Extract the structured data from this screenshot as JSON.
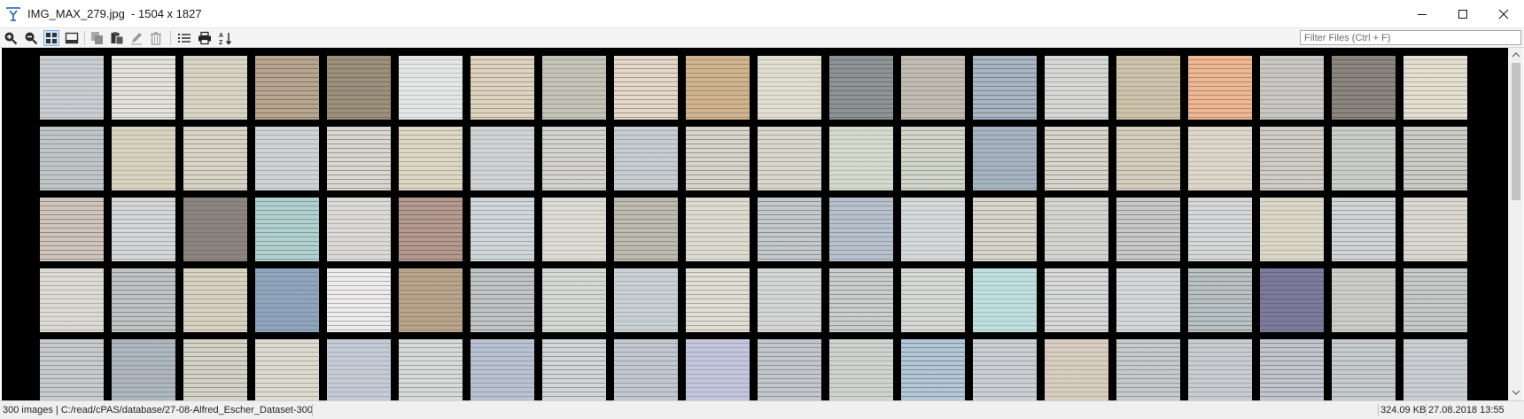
{
  "window": {
    "title": "IMG_MAX_279.jpg  - 1504 x 1827"
  },
  "toolbar": {
    "buttons": [
      {
        "name": "zoom-in",
        "icon": "zoom-in-icon"
      },
      {
        "name": "zoom-out",
        "icon": "zoom-out-icon"
      },
      {
        "name": "grid-view",
        "icon": "grid-view-icon",
        "active": true
      },
      {
        "name": "single-view",
        "icon": "single-view-icon"
      },
      {
        "name": "copy",
        "icon": "copy-icon",
        "disabled": true
      },
      {
        "name": "paste",
        "icon": "paste-icon"
      },
      {
        "name": "rename",
        "icon": "pencil-icon",
        "disabled": true
      },
      {
        "name": "delete",
        "icon": "trash-icon",
        "disabled": true
      },
      {
        "name": "list",
        "icon": "list-icon"
      },
      {
        "name": "print",
        "icon": "printer-icon"
      },
      {
        "name": "sort",
        "icon": "sort-az-icon"
      }
    ],
    "filter_placeholder": "Filter Files (Ctrl + F)"
  },
  "gallery": {
    "columns": 20,
    "visible_rows": 5,
    "thumbnail_tints": [
      [
        "#c9ccd0",
        "#e3e2dc",
        "#d8d5c6",
        "#b7a790",
        "#9b907c",
        "#e4e6e6",
        "#ddd3bf",
        "#c4c3b7",
        "#e4d7cb",
        "#d0b490",
        "#e0ddd1",
        "#8e9396",
        "#c1bcb3",
        "#a8b5c3",
        "#d7d8d6",
        "#cdc2ac",
        "#edb892",
        "#c8c7c4",
        "#8b8580",
        "#e3e0d2"
      ],
      [
        "#c0c5c8",
        "#d7d3c0",
        "#d8d5c8",
        "#d0d3d6",
        "#d9d7cf",
        "#dcd8c4",
        "#cfd3d6",
        "#d3d3cf",
        "#c8cdd2",
        "#d6d5cc",
        "#d8d7ce",
        "#d6dace",
        "#d2d5c9",
        "#a6b3c0",
        "#d7d5cc",
        "#d5cebf",
        "#dcd7ca",
        "#d0cdc6",
        "#c8cdc9",
        "#cbcdc6"
      ],
      [
        "#d0c5bd",
        "#d4d6d7",
        "#8c8480",
        "#b1d1d0",
        "#dad9d6",
        "#b49a90",
        "#cfd7da",
        "#dcdcd4",
        "#bdbcb1",
        "#dddbd1",
        "#c3c9cc",
        "#b7c1ce",
        "#d5d8d8",
        "#d8d5cb",
        "#d3d3d0",
        "#c7c8c8",
        "#d5d7d8",
        "#dad6c8",
        "#d1d5d6",
        "#dad8d0"
      ],
      [
        "#dcdad4",
        "#c0c3c4",
        "#d7d3c3",
        "#8fa5bd",
        "#ededed",
        "#b8a48c",
        "#bfc4c6",
        "#d5d9d4",
        "#c9d0d4",
        "#e0dfd6",
        "#d4d6d6",
        "#c9cfcd",
        "#d6d8d5",
        "#bfdfdf",
        "#d7d9d8",
        "#d4d7d9",
        "#b8c1c4",
        "#7d7a9e",
        "#cbcbc8",
        "#c5c9c8"
      ],
      [
        "#c8cbcc",
        "#aeb6bf",
        "#d5d3c8",
        "#dcdbd1",
        "#c5cbd6",
        "#d6dad9",
        "#b8c2d2",
        "#d2d6d9",
        "#c2c8d1",
        "#c2c5dc",
        "#c3c6cd",
        "#cfd3cf",
        "#b2c7d8",
        "#cbcfd3",
        "#d7cdc0",
        "#c6c9cd",
        "#c8ccd0",
        "#c2c5cd",
        "#c6cbcc",
        "#cacdd2"
      ]
    ]
  },
  "status": {
    "left": "300 images | C:/read/cPAS/database/27-08-Alfred_Escher_Dataset-300",
    "size": "324.09 KB",
    "date": "27.08.2018 13:55"
  }
}
